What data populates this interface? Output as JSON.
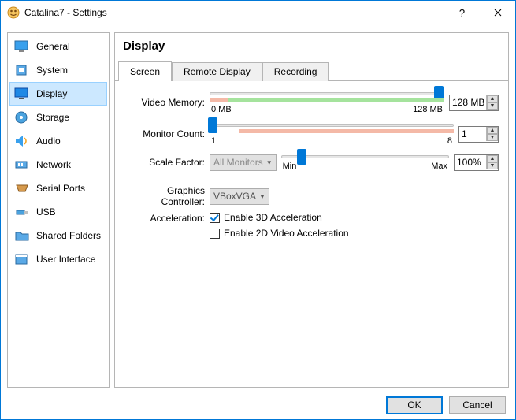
{
  "titlebar": {
    "title": "Catalina7 - Settings"
  },
  "sidebar": {
    "items": [
      {
        "label": "General"
      },
      {
        "label": "System"
      },
      {
        "label": "Display"
      },
      {
        "label": "Storage"
      },
      {
        "label": "Audio"
      },
      {
        "label": "Network"
      },
      {
        "label": "Serial Ports"
      },
      {
        "label": "USB"
      },
      {
        "label": "Shared Folders"
      },
      {
        "label": "User Interface"
      }
    ],
    "selected_index": 2
  },
  "page": {
    "title": "Display",
    "tabs": [
      {
        "label": "Screen"
      },
      {
        "label": "Remote Display"
      },
      {
        "label": "Recording"
      }
    ],
    "active_tab_index": 0,
    "video_memory": {
      "label": "Video Memory:",
      "value": "128 MB",
      "min_label": "0 MB",
      "max_label": "128 MB",
      "thumb_pct": 98,
      "red_start_pct": 0,
      "red_end_pct": 8,
      "green_start_pct": 8,
      "green_end_pct": 100
    },
    "monitor_count": {
      "label": "Monitor Count:",
      "value": "1",
      "min_label": "1",
      "max_label": "8",
      "thumb_pct": 0,
      "red_start_pct": 12,
      "red_end_pct": 100
    },
    "scale_factor": {
      "label": "Scale Factor:",
      "dropdown": "All Monitors",
      "value": "100%",
      "min_label": "Min",
      "max_label": "Max",
      "thumb_pct": 12
    },
    "graphics_controller": {
      "label": "Graphics Controller:",
      "value": "VBoxVGA"
    },
    "acceleration": {
      "label": "Acceleration:",
      "enable3d": {
        "label": "Enable 3D Acceleration",
        "checked": true
      },
      "enable2d": {
        "label": "Enable 2D Video Acceleration",
        "checked": false
      }
    }
  },
  "footer": {
    "ok": "OK",
    "cancel": "Cancel"
  }
}
